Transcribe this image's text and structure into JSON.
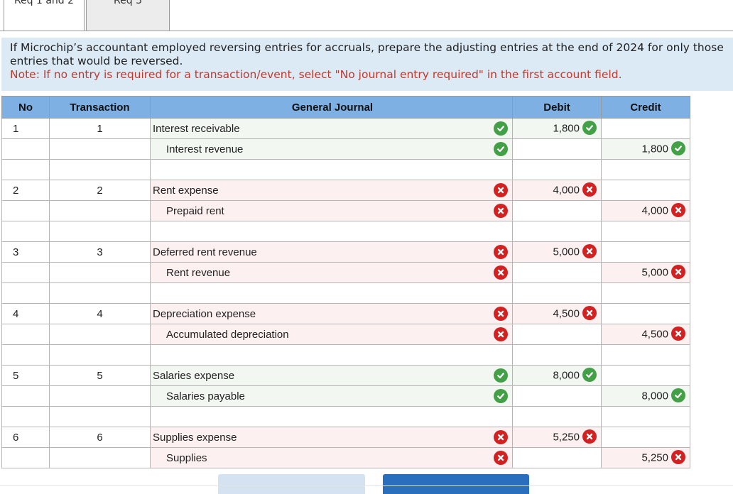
{
  "tabs": [
    {
      "label": "Req 1 and 2"
    },
    {
      "label": "Req 3"
    }
  ],
  "instructions": {
    "text": "If Microchip’s accountant employed reversing entries for accruals, prepare the adjusting entries at the end of 2024 for only those entries that would be reversed.",
    "note": "Note: If no entry is required for a transaction/event, select \"No journal entry required\" in the first account field."
  },
  "table": {
    "headers": {
      "no": "No",
      "transaction": "Transaction",
      "general_journal": "General Journal",
      "debit": "Debit",
      "credit": "Credit"
    },
    "entries": [
      {
        "no": "1",
        "transaction": "1",
        "debit_account": "Interest receivable",
        "credit_account": "Interest revenue",
        "debit": "1,800",
        "credit": "1,800",
        "status": "correct"
      },
      {
        "no": "2",
        "transaction": "2",
        "debit_account": "Rent expense",
        "credit_account": "Prepaid rent",
        "debit": "4,000",
        "credit": "4,000",
        "status": "incorrect"
      },
      {
        "no": "3",
        "transaction": "3",
        "debit_account": "Deferred rent revenue",
        "credit_account": "Rent revenue",
        "debit": "5,000",
        "credit": "5,000",
        "status": "incorrect"
      },
      {
        "no": "4",
        "transaction": "4",
        "debit_account": "Depreciation expense",
        "credit_account": "Accumulated depreciation",
        "debit": "4,500",
        "credit": "4,500",
        "status": "incorrect"
      },
      {
        "no": "5",
        "transaction": "5",
        "debit_account": "Salaries expense",
        "credit_account": "Salaries payable",
        "debit": "8,000",
        "credit": "8,000",
        "status": "correct"
      },
      {
        "no": "6",
        "transaction": "6",
        "debit_account": "Supplies expense",
        "credit_account": "Supplies",
        "debit": "5,250",
        "credit": "5,250",
        "status": "incorrect"
      }
    ]
  },
  "colors": {
    "header_bg": "#7fb0e3",
    "instr_bg": "#dceaf6",
    "note": "#c0392b",
    "correct": "#43a047",
    "incorrect": "#d32020",
    "next_button": "#2a6fbd"
  },
  "icons": {
    "correct": "check-circle-icon",
    "incorrect": "x-circle-icon"
  }
}
